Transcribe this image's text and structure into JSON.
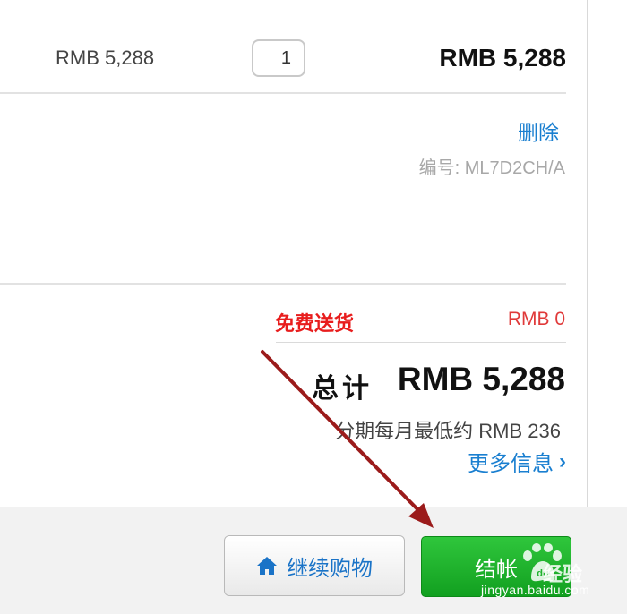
{
  "item": {
    "unit_price": "RMB 5,288",
    "quantity": "1",
    "line_total": "RMB 5,288",
    "remove_label": "删除",
    "part_number": "编号: ML7D2CH/A"
  },
  "summary": {
    "shipping_label": "免费送货",
    "shipping_value": "RMB 0",
    "total_label": "总计",
    "total_value": "RMB 5,288",
    "installment_text": "分期每月最低约 RMB 236",
    "more_info_label": "更多信息"
  },
  "actions": {
    "continue_label": "继续购物",
    "checkout_label": "结帐"
  },
  "watermark": {
    "brand": "经验",
    "url": "jingyan.baidu.com"
  },
  "colors": {
    "link": "#1a7fd0",
    "shipping_red": "#e81d1d",
    "checkout_green": "#1fb22e",
    "annotation_arrow": "#9b1b1b"
  },
  "icons": {
    "continue_button_icon": "home-icon",
    "more_info_icon": "chevron-right-icon",
    "annotation": "arrow-icon"
  }
}
